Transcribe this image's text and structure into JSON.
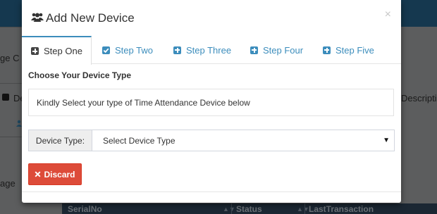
{
  "background": {
    "left_text_1": "ge C",
    "left_text_2": "De",
    "left_text_3": "age",
    "right_text": "Descriptio",
    "table_headers": [
      "SerialNo",
      "Status",
      "LastTransaction"
    ]
  },
  "modal": {
    "title": "Add New Device",
    "title_icon": "users-icon",
    "close_label": "×",
    "tabs": [
      {
        "label": "Step One",
        "icon": "plus-square-icon",
        "active": true
      },
      {
        "label": "Step Two",
        "icon": "check-square-icon",
        "active": false
      },
      {
        "label": "Step Three",
        "icon": "plus-square-icon",
        "active": false
      },
      {
        "label": "Step Four",
        "icon": "plus-square-icon",
        "active": false
      },
      {
        "label": "Step Five",
        "icon": "plus-square-icon",
        "active": false
      }
    ],
    "section_title": "Choose Your Device Type",
    "info_text": "Kindly Select your type of Time Attendance Device below",
    "device_type": {
      "label": "Device Type:",
      "selected": "Select Device Type"
    },
    "discard_label": "Discard",
    "discard_icon": "x-icon"
  },
  "colors": {
    "accent": "#3c8dbc",
    "danger": "#dd4b39",
    "topbar": "#15384f"
  }
}
